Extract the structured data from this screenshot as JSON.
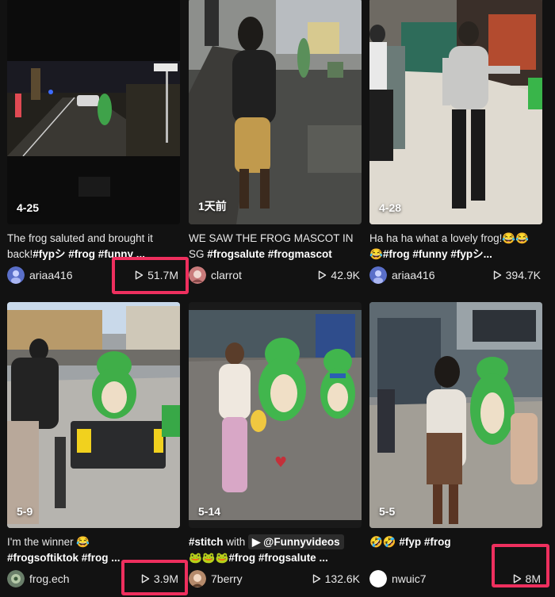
{
  "highlight_color": "#ee2f5e",
  "videos": [
    {
      "date": "4-25",
      "caption_text": "The frog saluted and brought it back!",
      "caption_tags": "#fypシ #frog #funny ...",
      "author": "ariaa416",
      "views": "51.7M",
      "highlighted": true
    },
    {
      "date": "1天前",
      "caption_text": "WE SAW THE FROG MASCOT IN SG ",
      "caption_tags": "#frogsalute #frogmascot",
      "author": "clarrot",
      "views": "42.9K",
      "highlighted": false
    },
    {
      "date": "4-28",
      "caption_text": "Ha ha ha what a lovely frog!😂😂😂",
      "caption_tags": "#frog #funny #fypシ...",
      "author": "ariaa416",
      "views": "394.7K",
      "highlighted": false
    },
    {
      "date": "5-9",
      "caption_text": "I'm the winner 😂",
      "caption_tags": "#frogsoftiktok #frog ...",
      "author": "frog.ech",
      "views": "3.9M",
      "highlighted": true
    },
    {
      "date": "5-14",
      "caption_prefix": "#stitch",
      "caption_with": " with ",
      "caption_mention": "▶ @Funnyvideos",
      "caption_tags": "🐸🐸🐸#frog #frogsalute ...",
      "author": "7berry",
      "views": "132.6K",
      "highlighted": false
    },
    {
      "date": "5-5",
      "caption_text": "🤣🤣 ",
      "caption_tags": "#fyp #frog",
      "author": "nwuic7",
      "views": "8M",
      "highlighted": true
    }
  ],
  "icons": {
    "views": "play-outline-icon"
  }
}
